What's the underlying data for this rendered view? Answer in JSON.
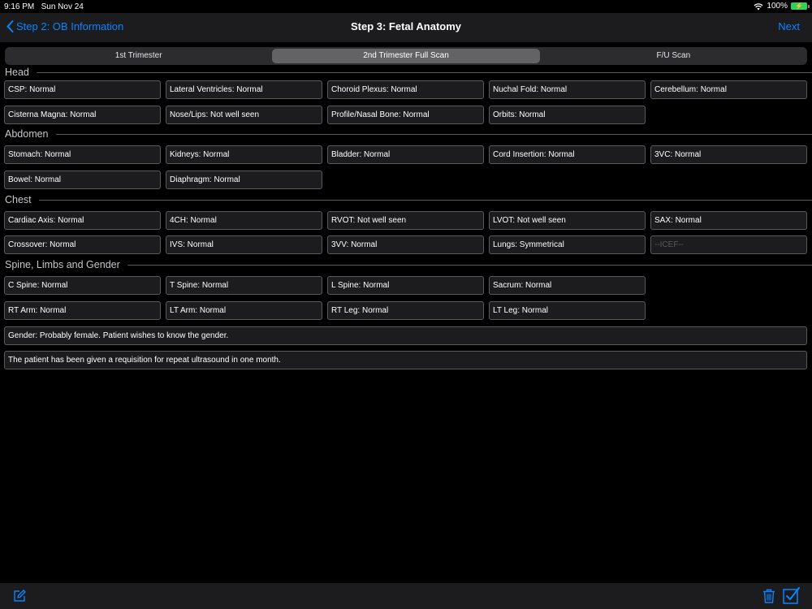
{
  "status_bar": {
    "time": "9:16 PM",
    "date": "Sun Nov 24",
    "battery": "100%"
  },
  "nav": {
    "back_label": "Step 2: OB Information",
    "title": "Step 3: Fetal Anatomy",
    "next_label": "Next"
  },
  "tabs": [
    {
      "label": "1st Trimester",
      "selected": false
    },
    {
      "label": "2nd Trimester Full Scan",
      "selected": true
    },
    {
      "label": "F/U Scan",
      "selected": false
    }
  ],
  "sections": {
    "head": {
      "title": "Head",
      "fields": [
        "CSP: Normal",
        "Lateral Ventricles: Normal",
        "Choroid Plexus: Normal",
        "Nuchal Fold: Normal",
        "Cerebellum: Normal",
        "Cisterna Magna: Normal",
        "Nose/Lips: Not well seen",
        "Profile/Nasal Bone: Normal",
        "Orbits: Normal"
      ]
    },
    "abdomen": {
      "title": "Abdomen",
      "fields": [
        "Stomach: Normal",
        "Kidneys: Normal",
        "Bladder: Normal",
        "Cord Insertion: Normal",
        "3VC: Normal",
        "Bowel: Normal",
        "Diaphragm: Normal"
      ]
    },
    "chest": {
      "title": "Chest",
      "fields": [
        "Cardiac Axis: Normal",
        "4CH: Normal",
        "RVOT: Not well seen",
        "LVOT: Not well seen",
        "SAX: Normal",
        "Crossover: Normal",
        "IVS: Normal",
        "3VV: Normal",
        "Lungs: Symmetrical"
      ],
      "icef_placeholder": "--ICEF--"
    },
    "spine": {
      "title": "Spine, Limbs and Gender",
      "fields": [
        "C Spine: Normal",
        "T Spine: Normal",
        "L Spine: Normal",
        "Sacrum: Normal",
        "RT Arm: Normal",
        "LT Arm: Normal",
        "RT Leg: Normal",
        "LT Leg: Normal"
      ],
      "gender": "Gender: Probably female. Patient wishes to know the gender.",
      "comment": "The patient has been given a requisition for repeat ultrasound in one month."
    }
  },
  "colors": {
    "accent": "#0a84ff",
    "background": "#000000",
    "field_bg": "#1c1c1e",
    "field_border": "#5a5a5e"
  }
}
